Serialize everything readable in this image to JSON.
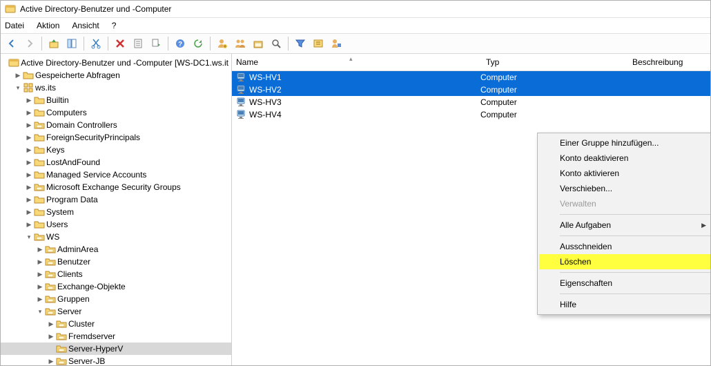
{
  "window": {
    "title": "Active Directory-Benutzer und -Computer"
  },
  "menubar": {
    "file": "Datei",
    "action": "Aktion",
    "view": "Ansicht",
    "help": "?"
  },
  "tree": {
    "root": "Active Directory-Benutzer und -Computer [WS-DC1.ws.it",
    "saved_queries": "Gespeicherte Abfragen",
    "domain": "ws.its",
    "builtin": "Builtin",
    "computers": "Computers",
    "dc": "Domain Controllers",
    "fsp": "ForeignSecurityPrincipals",
    "keys": "Keys",
    "laf": "LostAndFound",
    "msa": "Managed Service Accounts",
    "mesg": "Microsoft Exchange Security Groups",
    "pd": "Program Data",
    "system": "System",
    "users": "Users",
    "ws": "WS",
    "adminarea": "AdminArea",
    "benutzer": "Benutzer",
    "clients": "Clients",
    "exobj": "Exchange-Objekte",
    "gruppen": "Gruppen",
    "server": "Server",
    "cluster": "Cluster",
    "fremd": "Fremdserver",
    "hyperv": "Server-HyperV",
    "jb": "Server-JB"
  },
  "list": {
    "headers": {
      "name": "Name",
      "type": "Typ",
      "desc": "Beschreibung"
    },
    "rows": [
      {
        "name": "WS-HV1",
        "type": "Computer",
        "selected": true
      },
      {
        "name": "WS-HV2",
        "type": "Computer",
        "selected": true
      },
      {
        "name": "WS-HV3",
        "type": "Computer",
        "selected": false
      },
      {
        "name": "WS-HV4",
        "type": "Computer",
        "selected": false
      }
    ]
  },
  "ctx": {
    "add_group": "Einer Gruppe hinzufügen...",
    "deactivate": "Konto deaktivieren",
    "activate": "Konto aktivieren",
    "move": "Verschieben...",
    "manage": "Verwalten",
    "all_tasks": "Alle Aufgaben",
    "cut": "Ausschneiden",
    "delete": "Löschen",
    "props": "Eigenschaften",
    "help": "Hilfe"
  }
}
